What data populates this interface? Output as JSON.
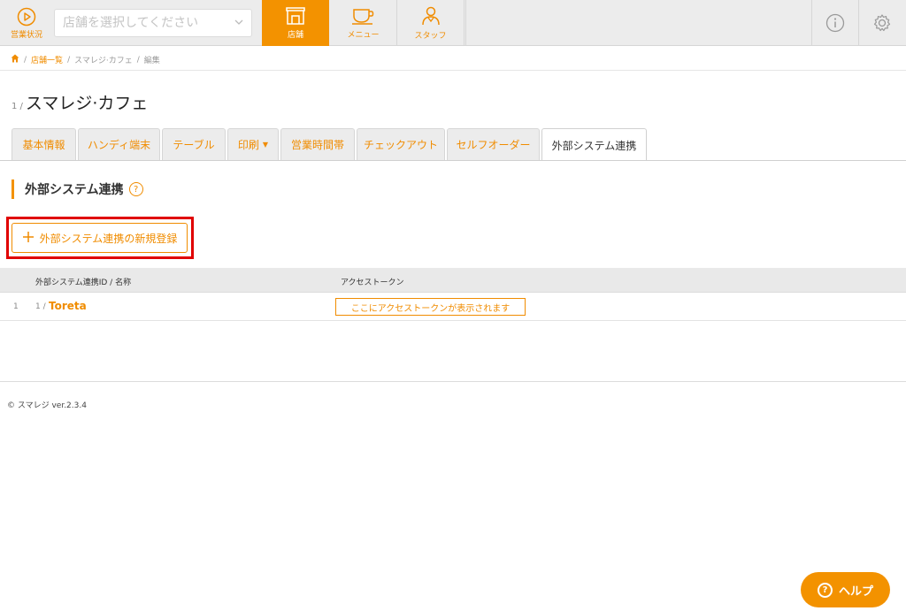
{
  "header": {
    "status_label": "営業状況",
    "store_select_placeholder": "店舗を選択してください",
    "nav": [
      {
        "label": "店舗",
        "icon": "store-icon",
        "active": true
      },
      {
        "label": "メニュー",
        "icon": "coffee-cup-icon",
        "active": false
      },
      {
        "label": "スタッフ",
        "icon": "staff-icon",
        "active": false
      }
    ],
    "info_icon": "info-icon",
    "settings_icon": "gear-icon"
  },
  "breadcrumb": {
    "home_icon": "home-icon",
    "items": [
      "店舗一覧",
      "スマレジ·カフェ",
      "編集"
    ],
    "separator": "/"
  },
  "store": {
    "id_prefix": "1 /",
    "name": "スマレジ·カフェ"
  },
  "tabs": [
    {
      "label": "基本情報",
      "active": false
    },
    {
      "label": "ハンディ端末",
      "active": false
    },
    {
      "label": "テーブル",
      "active": false
    },
    {
      "label": "印刷",
      "active": false,
      "dropdown": true
    },
    {
      "label": "営業時間帯",
      "active": false
    },
    {
      "label": "チェックアウト",
      "active": false
    },
    {
      "label": "セルフオーダー",
      "active": false
    },
    {
      "label": "外部システム連携",
      "active": true
    }
  ],
  "section": {
    "title": "外部システム連携",
    "help_glyph": "?",
    "add_button_label": "外部システム連携の新規登録",
    "add_button_icon": "plus-icon"
  },
  "table": {
    "columns": [
      "外部システム連携ID / 名称",
      "アクセストークン"
    ],
    "rows": [
      {
        "num": "1",
        "id_prefix": "1 /",
        "name": "Toreta",
        "token_text": "ここにアクセストークンが表示されます"
      }
    ]
  },
  "footer": {
    "copyright": "© スマレジ ver.2.3.4"
  },
  "help_fab": {
    "glyph": "?",
    "label": "ヘルプ"
  },
  "colors": {
    "accent": "#f39200",
    "highlight": "#e00000"
  }
}
